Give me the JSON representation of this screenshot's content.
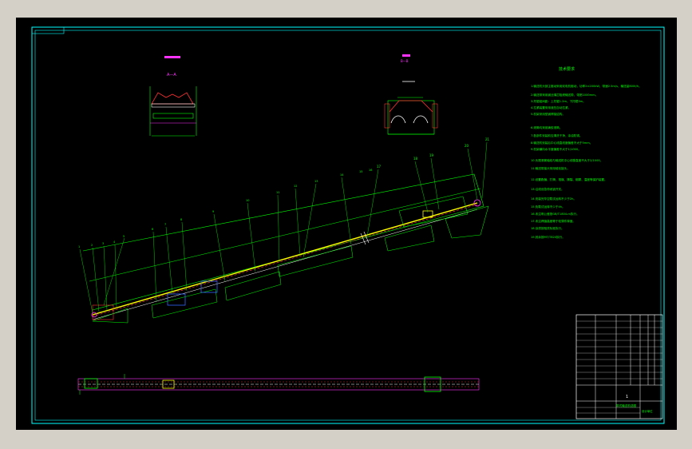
{
  "drawing": {
    "notes_title": "技术要求",
    "notes": [
      "1.输送机头部主驱动采用双电机驱动，功率2×200kW，带速2.5m/s，输送量800t/h。",
      "2.输送带采用钢丝绳芯阻燃输送带，带宽1000mm。",
      "3.托辊组间距：上托辊1.2m，下托辊3m。",
      "4.拉紧装置采用液压自动拉紧。",
      "5.机架采用型钢焊接结构。",
      "6.滚筒均采用铸胶滚筒。",
      "7.各部件安装前应清洗干净，涂油防锈。",
      "8.输送机安装后中心线直线度偏差不大于5mm。",
      "9.机架横向水平度偏差不大于1/1000。",
      "10.头尾滚筒轴线与输送机中心线垂直度不大于2/1000。",
      "11.输送带接头采用硫化接头。",
      "12.设置跑偏、打滑、堆煤、撕裂、烟雾、温度等保护装置。",
      "13.沿线设急停闭锁开关。",
      "14.安装完毕空载试运转不少于2h。",
      "15.负载试运转不少于4h。",
      "16.未注明公差按GB/T1804-m执行。",
      "17.未注焊缝高度等于较薄件厚度。",
      "18.涂漆按相关标准执行。",
      "19.其余按MT/T820执行。"
    ],
    "section_labels": [
      "A—A",
      "B—B"
    ],
    "part_labels": [
      "1",
      "2",
      "3",
      "4",
      "5",
      "6",
      "7",
      "8",
      "9",
      "10",
      "11",
      "12",
      "13",
      "14",
      "15",
      "16",
      "17",
      "18",
      "19",
      "20",
      "21"
    ],
    "title_block": {
      "drawing_title": "带式输送机总图",
      "company": "设计单位",
      "sheet": "1"
    },
    "colors": {
      "line": "#00ff00",
      "frame": "#00ffff",
      "accent": "#ff33ff",
      "belt": "#ffff00",
      "belt_inner": "#ff3333",
      "white": "#ffffff"
    }
  }
}
